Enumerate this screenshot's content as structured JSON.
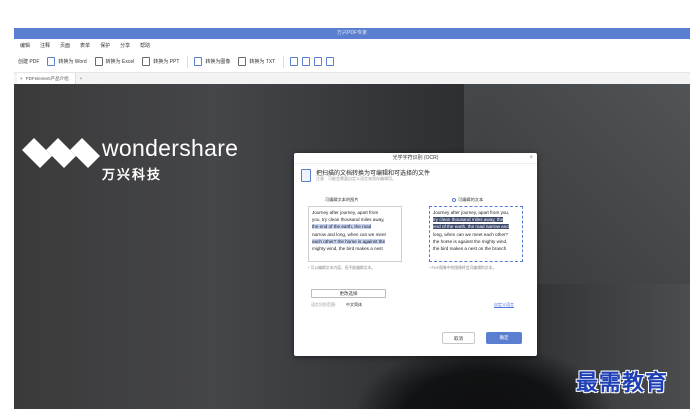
{
  "window": {
    "title": "万兴PDF专家"
  },
  "menu": {
    "items": [
      "编辑",
      "注释",
      "页面",
      "表单",
      "保护",
      "分享",
      "帮助"
    ]
  },
  "toolbar": {
    "items": [
      {
        "label": "创建 PDF",
        "icon": "create-pdf-icon"
      },
      {
        "label": "转换为 Word",
        "icon": "convert-word-icon"
      },
      {
        "label": "转换为 Excel",
        "icon": "convert-excel-icon"
      },
      {
        "label": "转换为 PPT",
        "icon": "convert-ppt-icon"
      },
      {
        "label": "转换为图像",
        "icon": "convert-image-icon"
      },
      {
        "label": "转换为 TXT",
        "icon": "convert-txt-icon"
      }
    ]
  },
  "tabs": [
    {
      "label": "PDFelement产品介绍"
    }
  ],
  "brand": {
    "name": "wondershare",
    "cn": "万兴科技"
  },
  "dialog": {
    "title": "光学字符识别 (OCR)",
    "heading": "把扫描的文档转换为可编辑和可选择的文件",
    "subheading": "注意：可能会需要自定义语言来保存编辑用。",
    "left_label": "可编辑文本的图片",
    "right_label": "可编辑的文本",
    "left_text": [
      "Journey after journey, apart from",
      "you, try clean thousand miles away,",
      "the end of the earth, the road",
      "narrow and long, when can we meet",
      "each other? the horse is against the",
      "mighty wind, the bird makes a nest"
    ],
    "right_text": [
      "Journey after journey, apart from you,",
      "try clean thousand miles away, the",
      "end of the earth, the road narrow and",
      "long, when can we meet each other?",
      "the horse is against the mighty wind,",
      "the bird makes a nest on the branch"
    ],
    "left_note": "* 可以编辑文本内容，但不能编辑文本。",
    "right_note": "* PDF图像中的图像将会可编辑和文本。",
    "change_button": "更改选择",
    "lang_label": "语言识别范围:",
    "lang_value": "中文简体",
    "lang_link": "自定义语言",
    "cancel": "取消",
    "ok": "确定"
  },
  "watermark": "最需教育"
}
